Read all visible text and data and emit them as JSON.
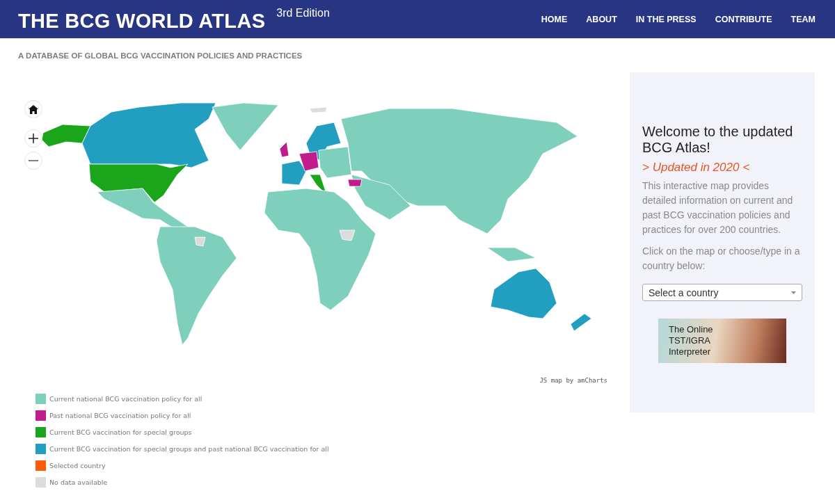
{
  "header": {
    "title": "THE BCG WORLD ATLAS",
    "edition": "3rd Edition",
    "nav": [
      "HOME",
      "ABOUT",
      "IN THE PRESS",
      "CONTRIBUTE",
      "TEAM"
    ]
  },
  "subtitle": "A DATABASE OF GLOBAL BCG VACCINATION POLICIES AND PRACTICES",
  "map": {
    "credit": "JS map by amCharts"
  },
  "legend": [
    {
      "label": "Current national BCG vaccination policy for all",
      "color": "#7fcfbd"
    },
    {
      "label": "Past national BCG vaccination policy for all",
      "color": "#c21b8e"
    },
    {
      "label": "Current BCG vaccination for special groups",
      "color": "#1aa51a"
    },
    {
      "label": "Current BCG vaccination for special groups and past national BCG vaccination for all",
      "color": "#229fc0"
    },
    {
      "label": "Selected country",
      "color": "#ff5a0a"
    },
    {
      "label": "No data available",
      "color": "#dcdcdc"
    }
  ],
  "sidebar": {
    "heading": "Welcome to the updated BCG Atlas!",
    "update_note": "> Updated in 2020 <",
    "intro": "This interactive map provides detailed information on current and past BCG vaccination policies and practices for over 200 countries.",
    "instruction": "Click on the map or choose/type in a country below:",
    "country_select": {
      "placeholder": "Select a country"
    },
    "banner": {
      "lines": [
        "The Online",
        "TST/IGRA",
        "Interpreter"
      ]
    }
  }
}
